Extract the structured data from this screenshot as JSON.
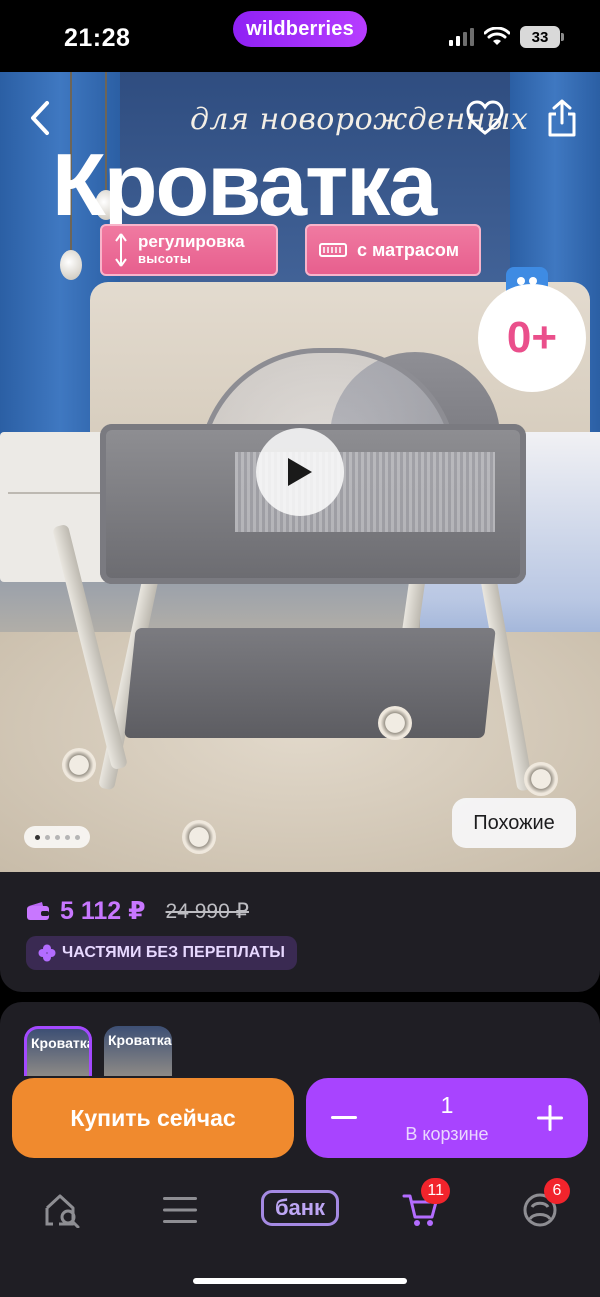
{
  "status_bar": {
    "time": "21:28",
    "brand": "wildberries",
    "battery": "33"
  },
  "hero": {
    "subtitle": "для новорожденных",
    "title": "Кроватка",
    "badge_height_line1": "регулировка",
    "badge_height_line2": "высоты",
    "badge_mattress": "с матрасом",
    "age_label": "0+",
    "similar_button": "Похожие",
    "gallery_dots": 5,
    "active_dot": 1
  },
  "price": {
    "current": "5 112 ₽",
    "old": "24 990 ₽",
    "installment": "ЧАСТЯМИ БЕЗ ПЕРЕПЛАТЫ"
  },
  "thumbnails": [
    {
      "label": "Кроватка",
      "selected": true
    },
    {
      "label": "Кроватка",
      "selected": false
    }
  ],
  "actions": {
    "buy_now": "Купить сейчас",
    "quantity": "1",
    "in_cart": "В корзине"
  },
  "tabbar": {
    "bank_label": "банк",
    "cart_badge": "11",
    "profile_badge": "6"
  },
  "colors": {
    "accent_purple": "#a844ff",
    "buy_orange": "#f08a2e",
    "price_purple": "#c877ff",
    "badge_red": "#f2242c"
  }
}
